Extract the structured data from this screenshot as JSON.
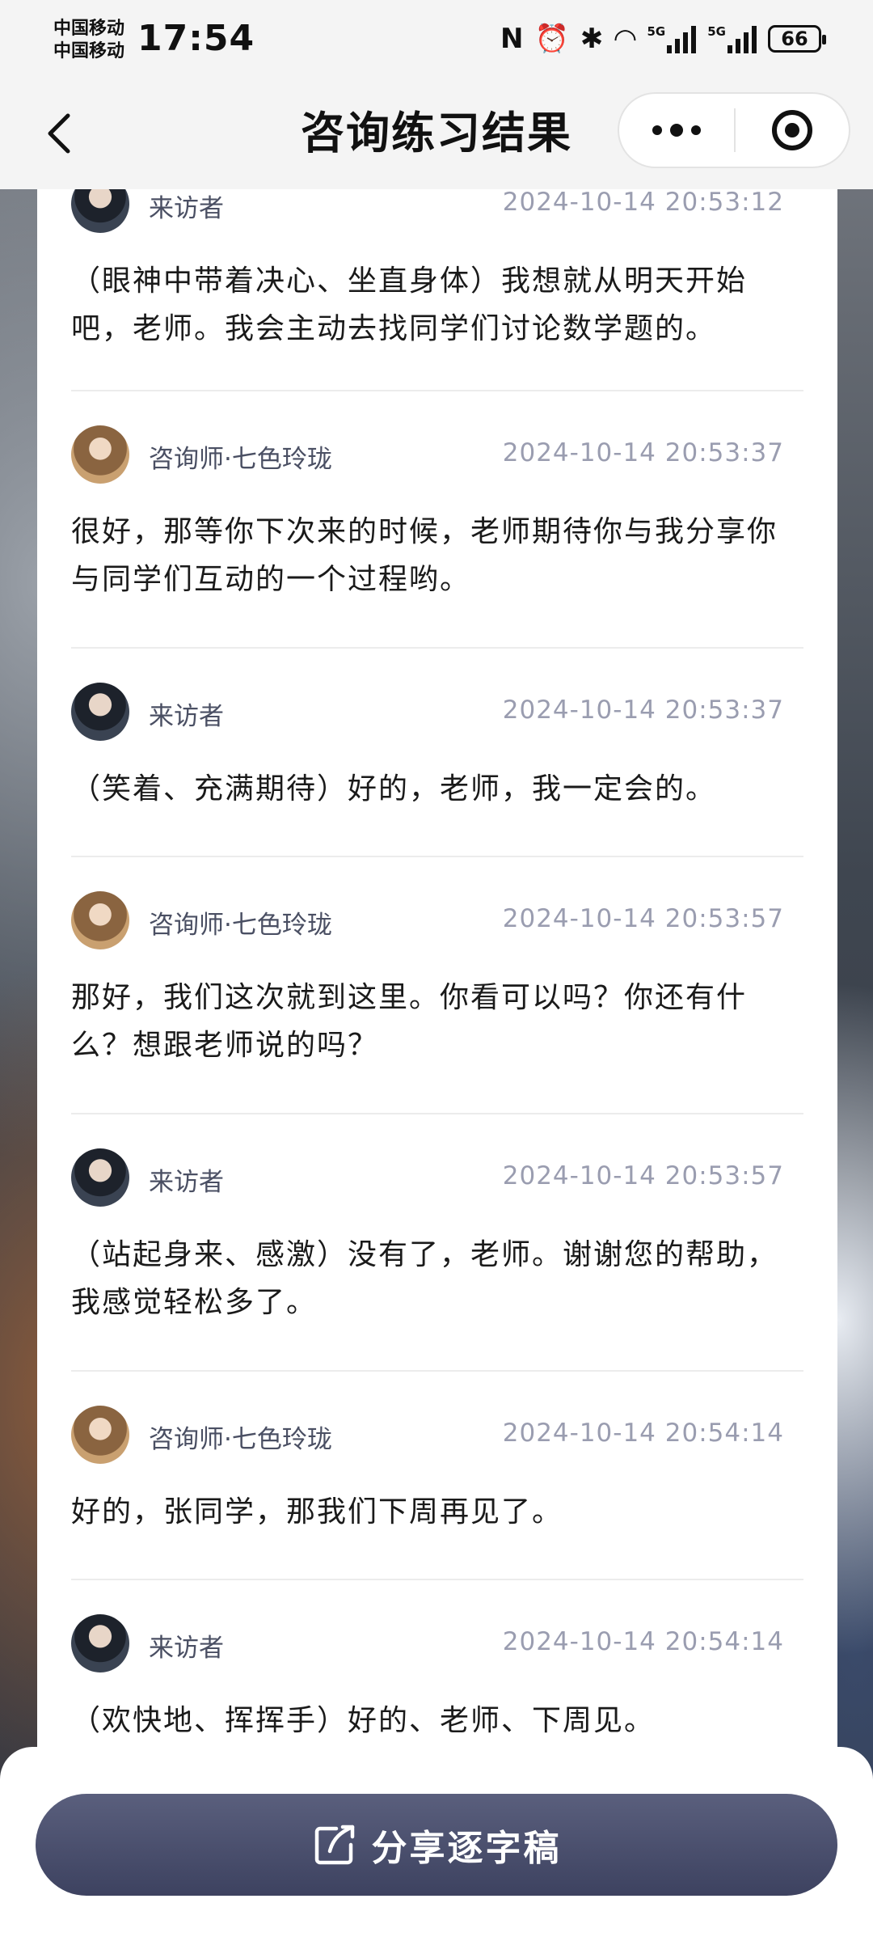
{
  "status_bar": {
    "carrier_1": "中国移动",
    "carrier_2": "中国移动",
    "time": "17:54",
    "nfc_icon": "N",
    "signal_label_1": "5G",
    "signal_label_2": "5G",
    "battery": "66"
  },
  "nav": {
    "title": "咨询练习结果"
  },
  "messages": [
    {
      "sender": "来访者",
      "role": "visitor",
      "time": "2024-10-14 20:53:12",
      "text": "（眼神中带着决心、坐直身体）我想就从明天开始吧，老师。我会主动去找同学们讨论数学题的。"
    },
    {
      "sender": "咨询师·七色玲珑",
      "role": "counselor",
      "time": "2024-10-14 20:53:37",
      "text": "很好，那等你下次来的时候，老师期待你与我分享你与同学们互动的一个过程哟。"
    },
    {
      "sender": "来访者",
      "role": "visitor",
      "time": "2024-10-14 20:53:37",
      "text": "（笑着、充满期待）好的，老师，我一定会的。"
    },
    {
      "sender": "咨询师·七色玲珑",
      "role": "counselor",
      "time": "2024-10-14 20:53:57",
      "text": "那好，我们这次就到这里。你看可以吗？你还有什么？想跟老师说的吗？"
    },
    {
      "sender": "来访者",
      "role": "visitor",
      "time": "2024-10-14 20:53:57",
      "text": "（站起身来、感激）没有了，老师。谢谢您的帮助，我感觉轻松多了。"
    },
    {
      "sender": "咨询师·七色玲珑",
      "role": "counselor",
      "time": "2024-10-14 20:54:14",
      "text": "好的，张同学，那我们下周再见了。"
    },
    {
      "sender": "来访者",
      "role": "visitor",
      "time": "2024-10-14 20:54:14",
      "text": "（欢快地、挥挥手）好的、老师、下周见。"
    }
  ],
  "share_button": {
    "label": "分享逐字稿",
    "icon": "share-icon"
  },
  "colors": {
    "button": "#4a4f6d",
    "sender": "#4a4f63",
    "time": "#9a9db0"
  }
}
